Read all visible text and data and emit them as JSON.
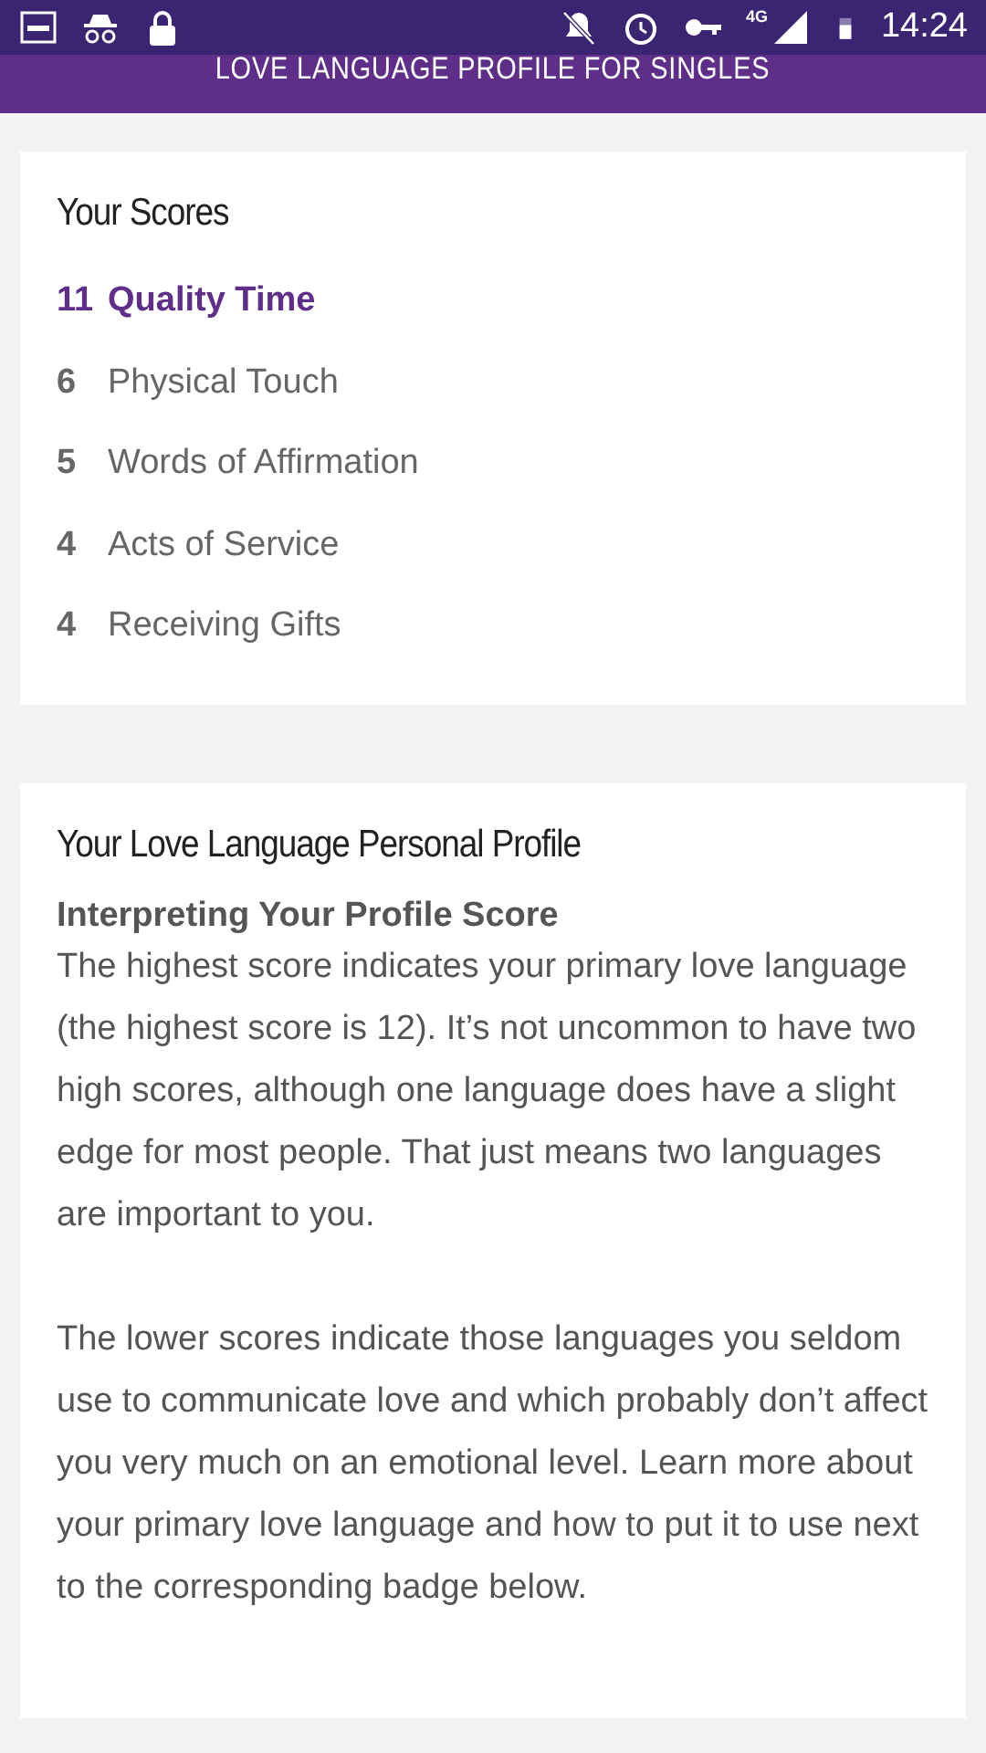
{
  "status_bar": {
    "time": "14:24",
    "network": "4G"
  },
  "header": {
    "title": "LOVE LANGUAGE PROFILE FOR SINGLES"
  },
  "scores_card": {
    "title": "Your Scores",
    "scores": [
      {
        "score": "11",
        "label": "Quality Time",
        "highlighted": true
      },
      {
        "score": "6",
        "label": "Physical Touch",
        "highlighted": false
      },
      {
        "score": "5",
        "label": "Words of Affirmation",
        "highlighted": false
      },
      {
        "score": "4",
        "label": "Acts of Service",
        "highlighted": false
      },
      {
        "score": "4",
        "label": "Receiving Gifts",
        "highlighted": false
      }
    ]
  },
  "profile_card": {
    "title": "Your Love Language Personal Profile",
    "subtitle": "Interpreting Your Profile Score",
    "paragraphs": [
      "The highest score indicates your primary love language (the highest score is 12). It’s not uncommon to have two high scores, although one language does have a slight edge for most people. That just means two languages are important to you.",
      "The lower scores indicate those languages you seldom use to communicate love and which probably don’t affect you very much on an emotional level. Learn more about your primary love language and how to put it to use next to the corresponding badge below."
    ]
  }
}
